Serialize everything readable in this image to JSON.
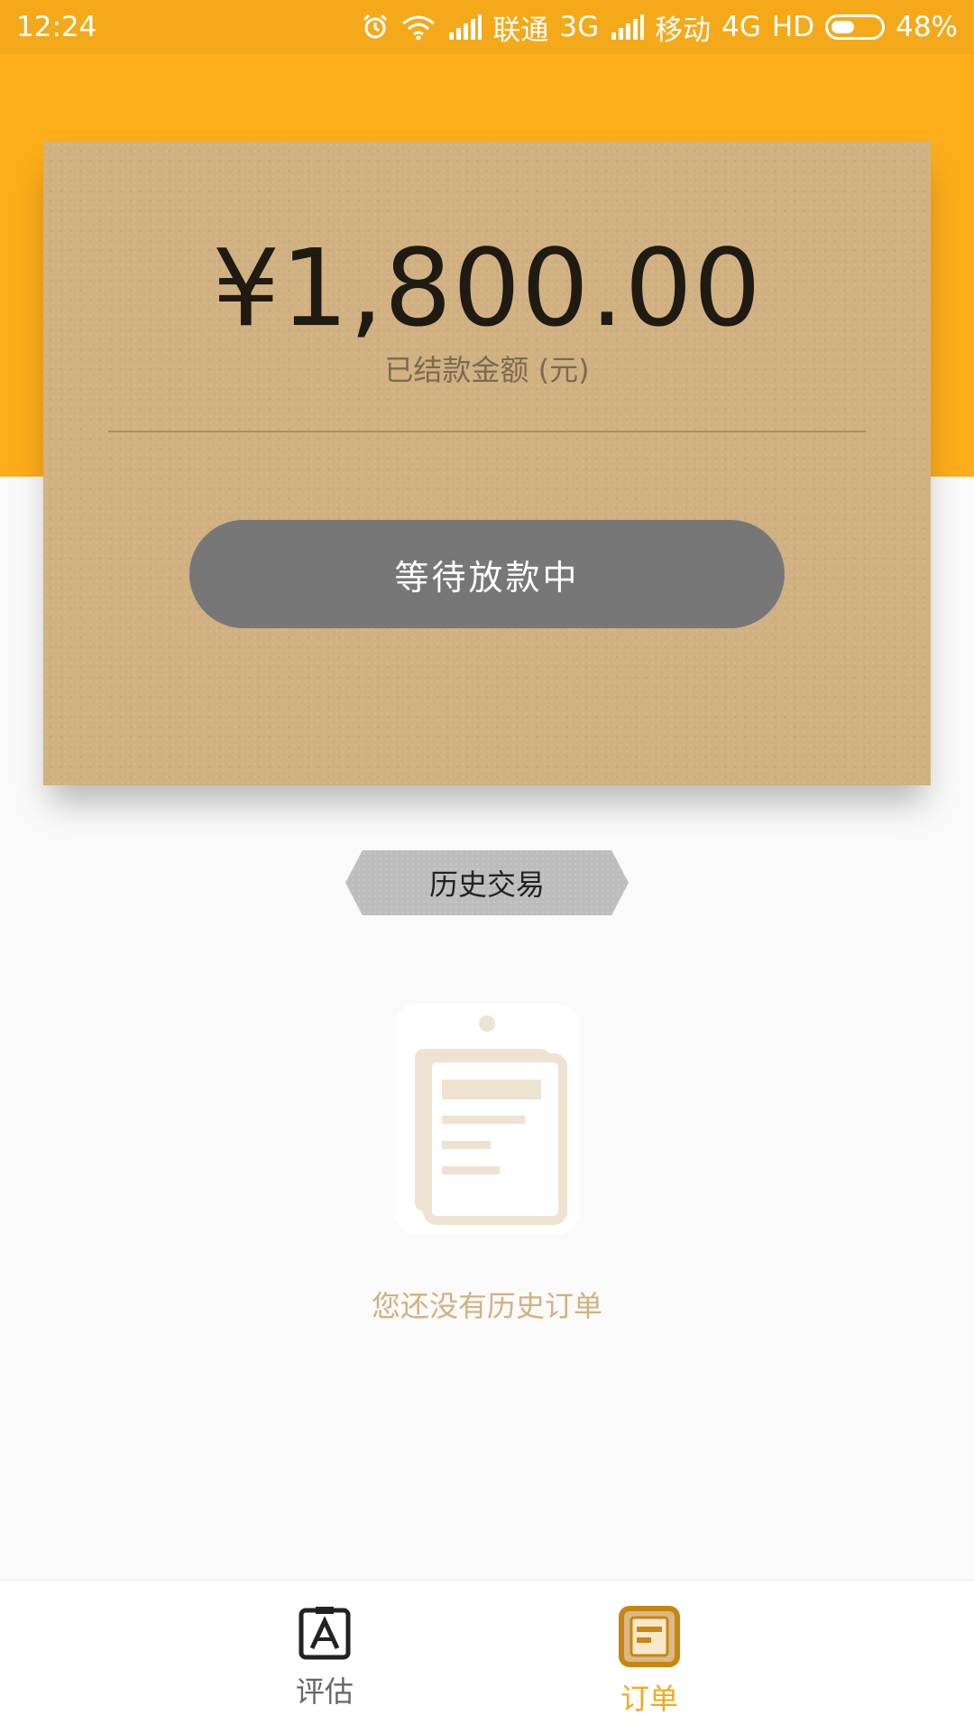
{
  "status_bar": {
    "time": "12:24",
    "carrier1": "联通",
    "network1": "3G",
    "carrier2": "移动",
    "network2": "4G",
    "hd": "HD",
    "battery_percent": "48%",
    "battery_level": 0.48,
    "icons": [
      "alarm-icon",
      "wifi-icon",
      "signal-icon",
      "signal-icon",
      "battery-icon"
    ]
  },
  "card": {
    "amount": "¥1,800.00",
    "caption": "已结款金额 (元)",
    "status_button_label": "等待放款中"
  },
  "history": {
    "label": "历史交易",
    "empty_icon": "clipboard-icon",
    "empty_text": "您还没有历史订单"
  },
  "tabs": [
    {
      "label": "评估",
      "icon": "assessment-icon",
      "active": false
    },
    {
      "label": "订单",
      "icon": "orders-icon",
      "active": true
    }
  ],
  "colors": {
    "primary": "#fcad1a",
    "card": "#d1b181",
    "button_gray": "#777777",
    "active_tab": "#f3a91a"
  }
}
